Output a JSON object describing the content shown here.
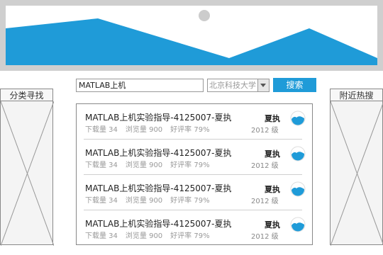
{
  "sidebar_left": {
    "label": "分类寻找"
  },
  "sidebar_right": {
    "label": "附近热搜"
  },
  "search": {
    "value": "MATLAB上机",
    "school": "北京科技大学",
    "button_label": "搜索"
  },
  "results": [
    {
      "title": "MATLAB上机实验指导-4125007-夏执",
      "downloads": "下载量 34",
      "views": "浏览量 900",
      "rating": "好评率 79%",
      "author": "夏执",
      "grade": "2012 级"
    },
    {
      "title": "MATLAB上机实验指导-4125007-夏执",
      "downloads": "下载量 34",
      "views": "浏览量 900",
      "rating": "好评率 79%",
      "author": "夏执",
      "grade": "2012 级"
    },
    {
      "title": "MATLAB上机实验指导-4125007-夏执",
      "downloads": "下载量 34",
      "views": "浏览量 900",
      "rating": "好评率 79%",
      "author": "夏执",
      "grade": "2012 级"
    },
    {
      "title": "MATLAB上机实验指导-4125007-夏执",
      "downloads": "下载量 34",
      "views": "浏览量 900",
      "rating": "好评率 79%",
      "author": "夏执",
      "grade": "2012 级"
    }
  ],
  "colors": {
    "accent": "#1f9bd8",
    "banner_frame": "#cfcfcf"
  },
  "icons": {
    "banner": "image-placeholder-icon",
    "avatar": "avatar-icon",
    "dropdown": "chevron-down-icon"
  }
}
